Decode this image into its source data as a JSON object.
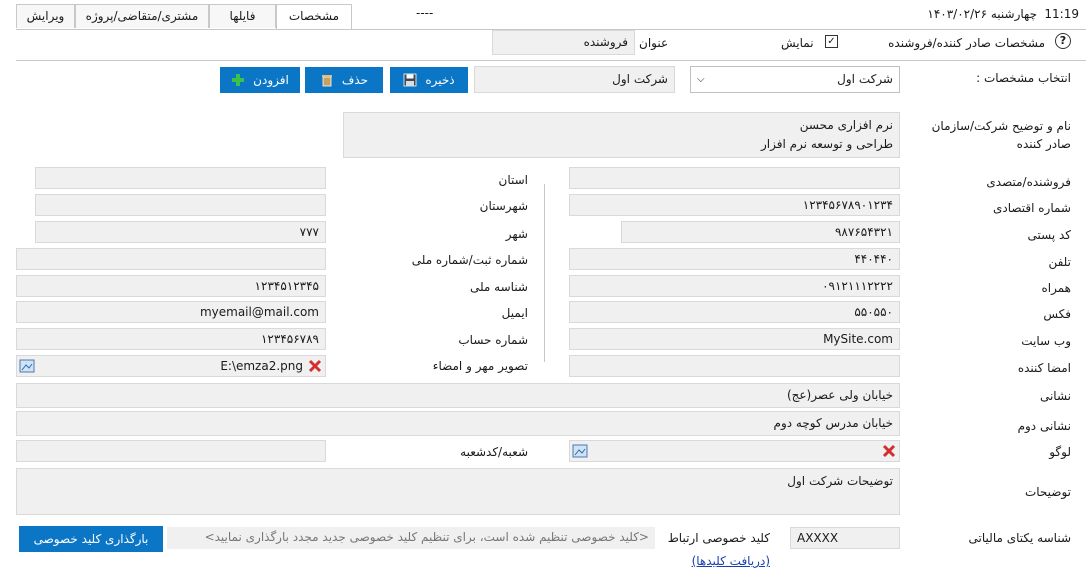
{
  "topbar": {
    "time": "11:19",
    "date": "چهارشنبه ۱۴۰۳/۰۲/۲۶",
    "center": "----"
  },
  "tabs": [
    {
      "label": "مشخصات"
    },
    {
      "label": "فایلها"
    },
    {
      "label": "مشتری/متقاضی/پروژه"
    },
    {
      "label": "ویرایش"
    }
  ],
  "header": {
    "title": "مشخصات صادر کننده/فروشنده",
    "show_label": "نمایش",
    "subject_label": "عنوان",
    "subject_value": "فروشنده"
  },
  "select_row": {
    "label": "انتخاب مشخصات :",
    "selected": "شرکت اول",
    "name_value": "شرکت اول",
    "save": "ذخیره",
    "delete": "حذف",
    "add": "افزودن"
  },
  "company": {
    "label_line1": "نام و توضیح شرکت/سازمان",
    "label_line2": "صادر کننده",
    "line1": "نرم افزاری محسن",
    "line2": "طراحی و توسعه نرم افزار"
  },
  "right_fields": [
    {
      "label": "فروشنده/متصدی",
      "value": ""
    },
    {
      "label": "شماره اقتصادی",
      "value": "۱۲۳۴۵۶۷۸۹۰۱۲۳۴"
    },
    {
      "label": "کد پستی",
      "value": "۹۸۷۶۵۴۳۲۱"
    },
    {
      "label": "تلفن",
      "value": "۴۴۰۴۴۰"
    },
    {
      "label": "همراه",
      "value": "۰۹۱۲۱۱۱۲۲۲۲"
    },
    {
      "label": "فکس",
      "value": "۵۵۰۵۵۰"
    },
    {
      "label": "وب سایت",
      "value": "MySite.com"
    },
    {
      "label": "امضا کننده",
      "value": ""
    }
  ],
  "mid_fields": [
    {
      "label": "استان",
      "value": ""
    },
    {
      "label": "شهرستان",
      "value": ""
    },
    {
      "label": "شهر",
      "value": "۷۷۷"
    },
    {
      "label": "شماره ثبت/شماره ملی",
      "value": ""
    },
    {
      "label": "شناسه ملی",
      "value": "۱۲۳۴۵۱۲۳۴۵"
    },
    {
      "label": "ایمیل",
      "value": "myemail@mail.com"
    },
    {
      "label": "شماره حساب",
      "value": "۱۲۳۴۵۶۷۸۹"
    },
    {
      "label": "تصویر مهر و امضاء",
      "value": "E:\\emza2.png"
    }
  ],
  "address": {
    "label": "نشانی",
    "value": "خیابان ولی عصر(عج)"
  },
  "address2": {
    "label": "نشانی دوم",
    "value": "خیابان مدرس کوچه دوم"
  },
  "logo": {
    "label": "لوگو"
  },
  "branch": {
    "label": "شعبه/کدشعبه",
    "value": ""
  },
  "description": {
    "label": "توضیحات",
    "value": "توضیحات شرکت اول"
  },
  "tax": {
    "label": "شناسه یکتای مالیاتی",
    "value": "AXXXX",
    "private_key_label": "کلید خصوصی ارتباط",
    "private_key_hint": "<کلید خصوصی تنظیم شده است، برای تنظیم کلید خصوصی جدید مجدد بارگذاری نمایید>",
    "get_keys_link": "(دریافت کلیدها)",
    "upload_button": "بارگذاری کلید خصوصی"
  },
  "colors": {
    "accent": "#0b76c6",
    "field_bg": "#f0f0f0",
    "border": "#d9d9d9",
    "delete_red": "#d32f2f",
    "add_green": "#2e9e3a"
  }
}
